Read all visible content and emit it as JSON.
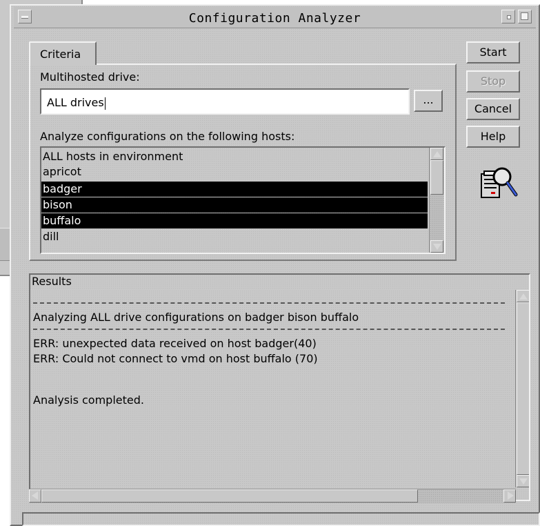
{
  "window": {
    "title": "Configuration Analyzer"
  },
  "tabs": [
    {
      "label": "Criteria",
      "selected": true
    }
  ],
  "criteria": {
    "drive_label": "Multihosted drive:",
    "drive_value": "ALL drives",
    "browse_label": "...",
    "hosts_label": "Analyze configurations on the following hosts:",
    "hosts": [
      {
        "name": "ALL hosts in environment",
        "selected": false
      },
      {
        "name": "apricot",
        "selected": false
      },
      {
        "name": "badger",
        "selected": true
      },
      {
        "name": "bison",
        "selected": true
      },
      {
        "name": "buffalo",
        "selected": true
      },
      {
        "name": "dill",
        "selected": false
      }
    ]
  },
  "buttons": {
    "start": "Start",
    "stop": "Stop",
    "cancel": "Cancel",
    "help": "Help"
  },
  "results": {
    "label": "Results",
    "lines": [
      "Analyzing ALL drive configurations on badger bison buffalo",
      "ERR: unexpected data received on host badger(40)",
      "ERR: Could not connect to vmd on host buffalo (70)",
      "Analysis completed."
    ]
  },
  "icons": {
    "window_menu": "window-menu-icon",
    "minimize": "minimize-icon",
    "maximize": "maximize-icon",
    "analyzer": "server-magnifier-icon"
  },
  "colors": {
    "background": "#c8c8c8",
    "selection": "#000000",
    "selection_text": "#ffffff"
  }
}
